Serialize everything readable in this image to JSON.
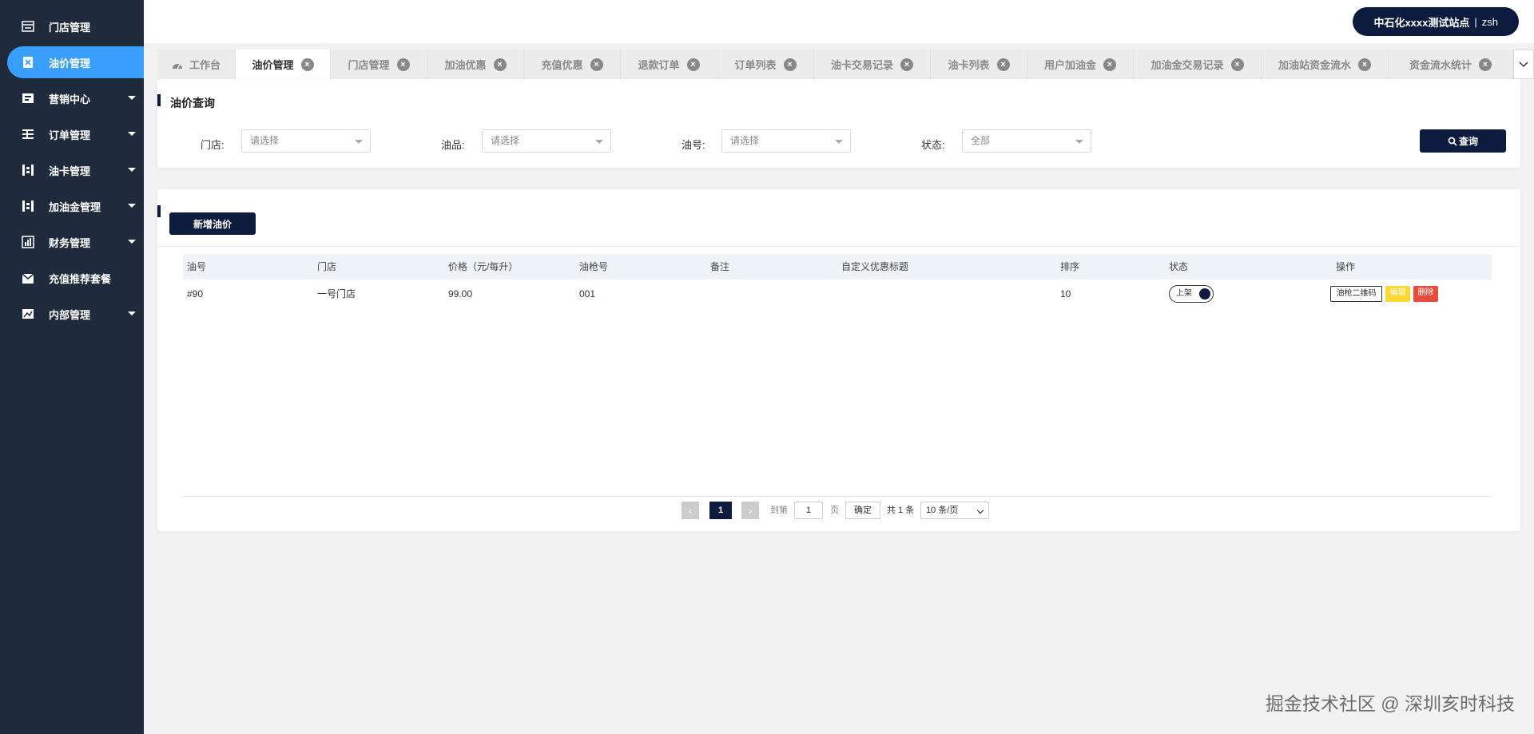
{
  "sidebar": {
    "items": [
      {
        "label": "门店管理",
        "icon": "store-icon",
        "expandable": false,
        "active": false
      },
      {
        "label": "油价管理",
        "icon": "price-icon",
        "expandable": false,
        "active": true
      },
      {
        "label": "营销中心",
        "icon": "marketing-icon",
        "expandable": true,
        "active": false
      },
      {
        "label": "订单管理",
        "icon": "order-icon",
        "expandable": true,
        "active": false
      },
      {
        "label": "油卡管理",
        "icon": "card-icon",
        "expandable": true,
        "active": false
      },
      {
        "label": "加油金管理",
        "icon": "fund-icon",
        "expandable": true,
        "active": false
      },
      {
        "label": "财务管理",
        "icon": "finance-icon",
        "expandable": true,
        "active": false
      },
      {
        "label": "充值推荐套餐",
        "icon": "package-icon",
        "expandable": false,
        "active": false
      },
      {
        "label": "内部管理",
        "icon": "internal-icon",
        "expandable": true,
        "active": false
      }
    ]
  },
  "header": {
    "station": "中石化xxxx测试站点",
    "separator": "|",
    "user": "zsh"
  },
  "tabs": [
    {
      "label": "工作台",
      "closable": false,
      "active": false
    },
    {
      "label": "油价管理",
      "closable": true,
      "active": true
    },
    {
      "label": "门店管理",
      "closable": true,
      "active": false
    },
    {
      "label": "加油优惠",
      "closable": true,
      "active": false
    },
    {
      "label": "充值优惠",
      "closable": true,
      "active": false
    },
    {
      "label": "退款订单",
      "closable": true,
      "active": false
    },
    {
      "label": "订单列表",
      "closable": true,
      "active": false
    },
    {
      "label": "油卡交易记录",
      "closable": true,
      "active": false
    },
    {
      "label": "油卡列表",
      "closable": true,
      "active": false
    },
    {
      "label": "用户加油金",
      "closable": true,
      "active": false
    },
    {
      "label": "加油金交易记录",
      "closable": true,
      "active": false
    },
    {
      "label": "加油站资金流水",
      "closable": true,
      "active": false
    },
    {
      "label": "资金流水统计",
      "closable": true,
      "active": false
    }
  ],
  "search": {
    "title": "油价查询",
    "store_label": "门店:",
    "store_value": "请选择",
    "product_label": "油品:",
    "product_value": "请选择",
    "number_label": "油号:",
    "number_value": "请选择",
    "status_label": "状态:",
    "status_value": "全部",
    "query_button": "查询"
  },
  "list": {
    "add_button": "新增油价",
    "columns": [
      "油号",
      "门店",
      "价格（元/每升）",
      "油枪号",
      "备注",
      "自定义优惠标题",
      "排序",
      "状态",
      "操作"
    ],
    "rows": [
      {
        "oil_no": "#90",
        "store": "一号门店",
        "price": "99.00",
        "gun_no": "001",
        "remark": "",
        "custom_title": "",
        "sort": "10",
        "status": "上架",
        "actions": {
          "qr": "油枪二维码",
          "edit": "编辑",
          "delete": "删除"
        }
      }
    ]
  },
  "pagination": {
    "prev": "‹",
    "current": "1",
    "next": "›",
    "goto_label": "到第",
    "goto_value": "1",
    "page_unit": "页",
    "ok": "确定",
    "total": "共 1 条",
    "page_size": "10 条/页"
  },
  "watermark": "掘金技术社区 @ 深圳亥时科技",
  "colors": {
    "sidebar_bg": "#1f2a3c",
    "active_blue": "#3a9efc",
    "navy": "#0d1b3e",
    "edit_yellow": "#fdd835",
    "delete_red": "#e74c3c"
  }
}
